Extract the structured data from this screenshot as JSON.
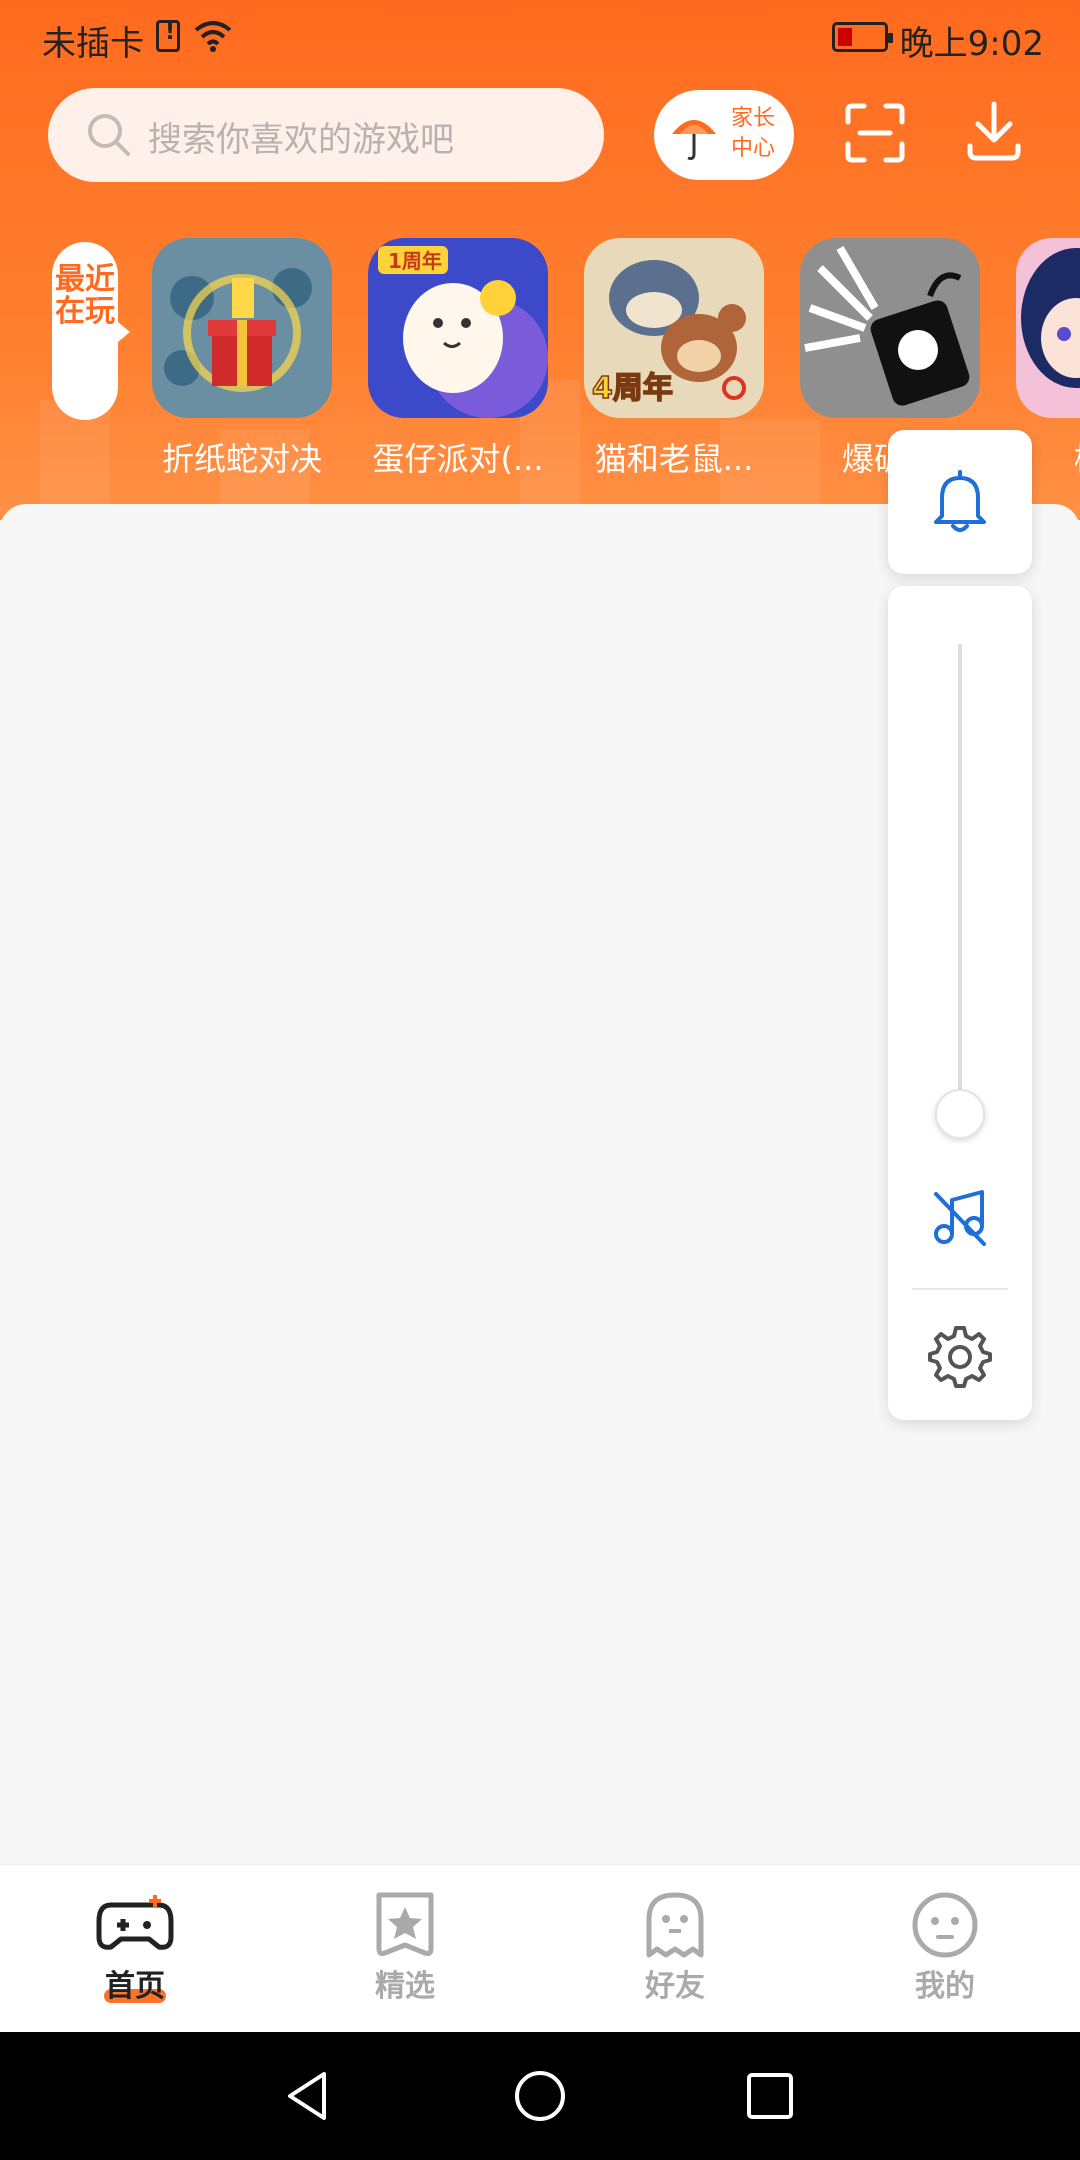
{
  "status_bar": {
    "carrier": "未插卡",
    "time": "晚上9:02"
  },
  "search": {
    "placeholder": "搜索你喜欢的游戏吧"
  },
  "header": {
    "parent_center_label": "家长中心",
    "parent_center_line1": "家长",
    "parent_center_line2": "中心"
  },
  "recent": {
    "tag_label": "最近在玩",
    "games": [
      {
        "name": "折纸蛇对决",
        "icon": "snake-game-icon"
      },
      {
        "name": "蛋仔派对(...",
        "icon": "eggy-party-icon"
      },
      {
        "name": "猫和老鼠...",
        "icon": "tom-jerry-icon"
      },
      {
        "name": "爆破模",
        "icon": "demolition-icon"
      },
      {
        "name": "樱花",
        "icon": "sakura-icon"
      }
    ]
  },
  "volume": {
    "level": 0
  },
  "bottom_nav": [
    {
      "label": "首页",
      "icon": "gamepad-icon",
      "active": true
    },
    {
      "label": "精选",
      "icon": "star-bookmark-icon",
      "active": false
    },
    {
      "label": "好友",
      "icon": "ghost-icon",
      "active": false
    },
    {
      "label": "我的",
      "icon": "smiley-icon",
      "active": false
    }
  ],
  "colors": {
    "brand": "#ff6a1f",
    "accent_blue": "#1e6fd9"
  }
}
